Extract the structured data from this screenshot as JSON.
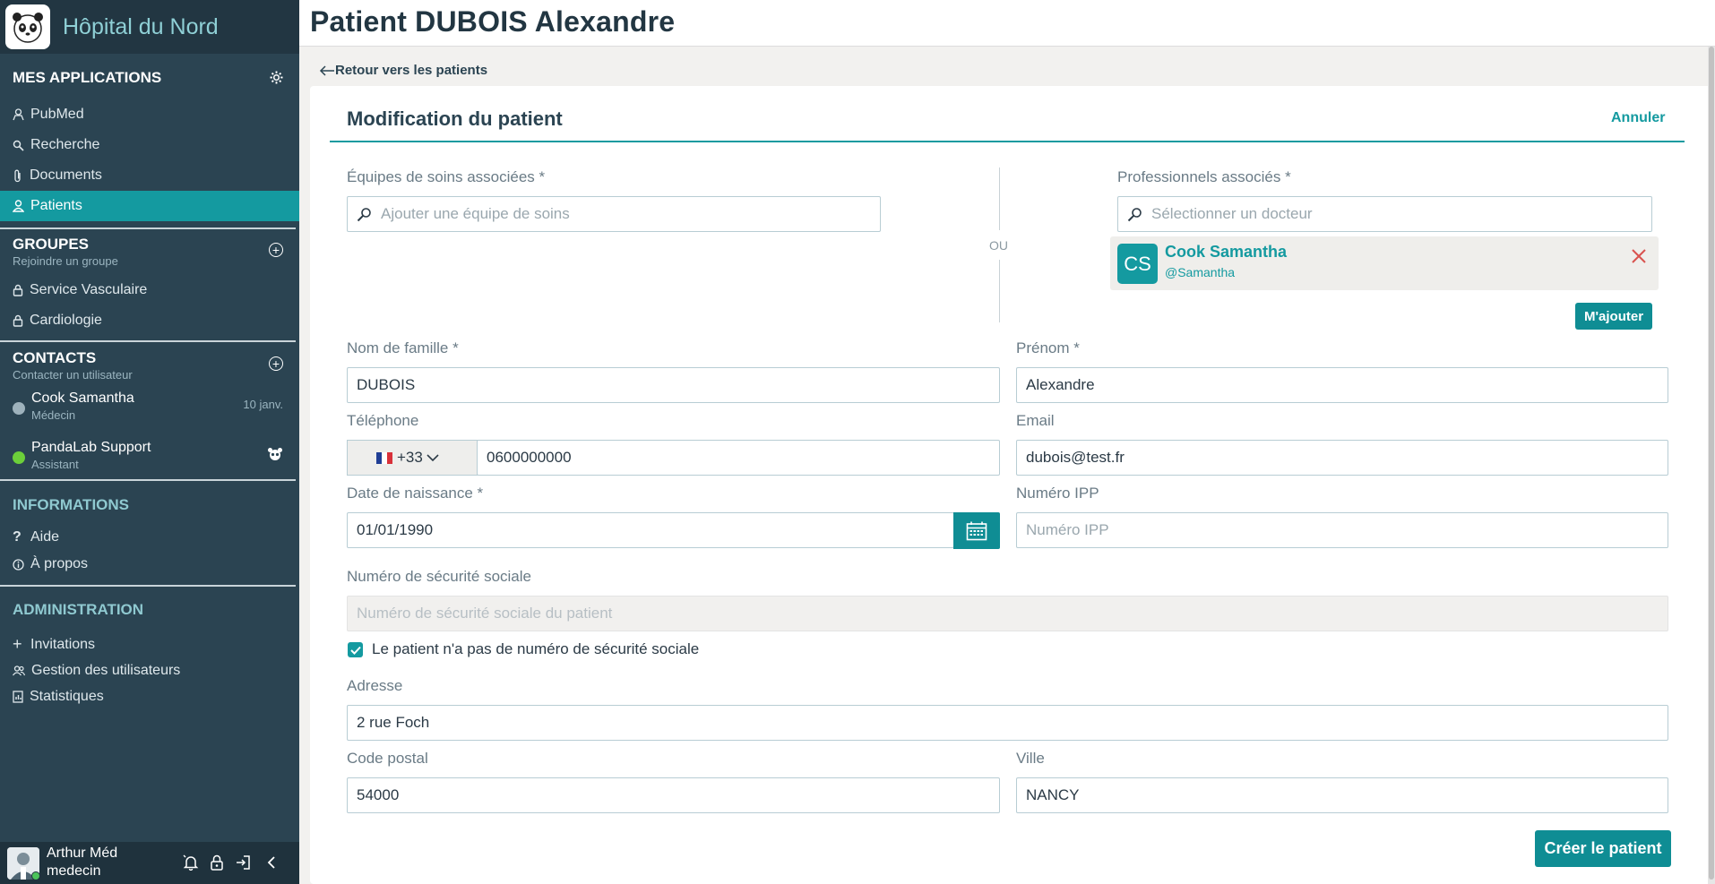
{
  "brand": {
    "name": "Hôpital du Nord",
    "logo": "panda-logo"
  },
  "sidebar": {
    "apps_title": "MES APPLICATIONS",
    "apps": [
      {
        "label": "PubMed",
        "icon": "pubmed-icon"
      },
      {
        "label": "Recherche",
        "icon": "search-icon"
      },
      {
        "label": "Documents",
        "icon": "paperclip-icon"
      },
      {
        "label": "Patients",
        "icon": "person-icon",
        "active": true
      }
    ],
    "groups_title": "GROUPES",
    "groups_sub": "Rejoindre un groupe",
    "groups": [
      {
        "label": "Service Vasculaire",
        "icon": "lock-icon"
      },
      {
        "label": "Cardiologie",
        "icon": "lock-icon"
      }
    ],
    "contacts_title": "CONTACTS",
    "contacts_sub": "Contacter un utilisateur",
    "contacts": [
      {
        "name": "Cook Samantha",
        "role": "Médecin",
        "date": "10 janv.",
        "status_color": "#9eb2bc"
      },
      {
        "name": "PandaLab Support",
        "role": "Assistant",
        "status_color": "#6ccf3a"
      }
    ],
    "info_title": "INFORMATIONS",
    "info": [
      {
        "label": "Aide",
        "icon": "question-icon"
      },
      {
        "label": "À propos",
        "icon": "info-icon"
      }
    ],
    "admin_title": "ADMINISTRATION",
    "admin": [
      {
        "label": "Invitations",
        "icon": "plus-icon"
      },
      {
        "label": "Gestion des utilisateurs",
        "icon": "users-icon"
      },
      {
        "label": "Statistiques",
        "icon": "chart-icon"
      }
    ]
  },
  "user": {
    "name": "Arthur Méd",
    "role": "medecin"
  },
  "header": {
    "title": "Patient DUBOIS Alexandre"
  },
  "back_link": "Retour vers les patients",
  "form": {
    "title": "Modification du patient",
    "cancel": "Annuler",
    "care_teams_label": "Équipes de soins associées *",
    "care_teams_placeholder": "Ajouter une équipe de soins",
    "or": "OU",
    "professionals_label": "Professionnels associés *",
    "professionals_placeholder": "Sélectionner un docteur",
    "doctor": {
      "initials": "CS",
      "name": "Cook Samantha",
      "handle": "@Samantha"
    },
    "add_me": "M'ajouter",
    "lastname_label": "Nom de famille *",
    "lastname": "DUBOIS",
    "firstname_label": "Prénom *",
    "firstname": "Alexandre",
    "phone_label": "Téléphone",
    "phone_prefix": "+33",
    "phone": "0600000000",
    "email_label": "Email",
    "email": "dubois@test.fr",
    "birth_label": "Date de naissance *",
    "birth": "01/01/1990",
    "ipp_label": "Numéro IPP",
    "ipp_placeholder": "Numéro IPP",
    "ssn_label": "Numéro de sécurité sociale",
    "ssn_placeholder": "Numéro de sécurité sociale du patient",
    "no_ssn_label": "Le patient n'a pas de numéro de sécurité sociale",
    "address_label": "Adresse",
    "address": "2 rue Foch",
    "postal_label": "Code postal",
    "postal": "54000",
    "city_label": "Ville",
    "city": "NANCY",
    "submit": "Créer le patient"
  },
  "colors": {
    "accent": "#149aa0",
    "sidebar": "#2b4452",
    "danger": "#d9534f"
  }
}
